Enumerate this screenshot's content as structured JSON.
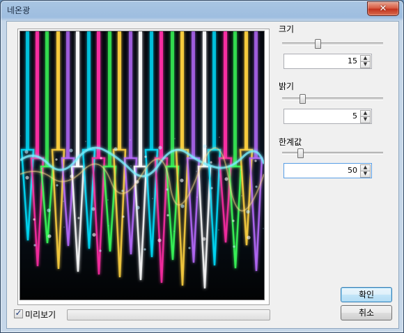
{
  "window": {
    "title": "네온광",
    "close_glyph": "✕"
  },
  "preview": {
    "image_alt": "glowing neon colored pencil tips",
    "colors": [
      "#00e0ff",
      "#ff2ea6",
      "#39ff5a",
      "#ffd23f",
      "#b86bff",
      "#ffffff"
    ]
  },
  "preview_toggle": {
    "label": "미리보기",
    "checked": true,
    "check_glyph": "✓"
  },
  "controls": {
    "size": {
      "label": "크기",
      "value": "15",
      "level": 0.35
    },
    "brightness": {
      "label": "밝기",
      "value": "5",
      "level": 0.2
    },
    "threshold": {
      "label": "한계값",
      "value": "50",
      "level": 0.18
    }
  },
  "spin_glyphs": {
    "up": "▲",
    "down": "▼"
  },
  "buttons": {
    "ok": "확인",
    "cancel": "취소"
  },
  "progress": {
    "level": 0
  }
}
